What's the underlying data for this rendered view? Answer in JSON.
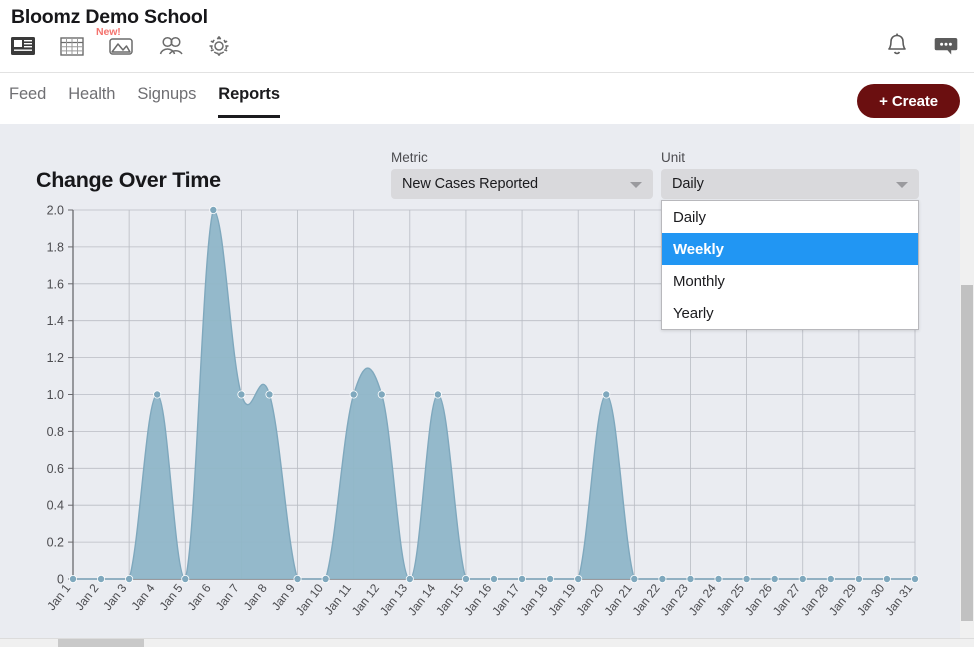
{
  "header": {
    "school_title": "Bloomz Demo School",
    "nav_icons": [
      {
        "name": "feed-icon",
        "label": "Feed"
      },
      {
        "name": "calendar-icon",
        "label": "Calendar"
      },
      {
        "name": "photos-icon",
        "label": "Photos",
        "badge": "New!"
      },
      {
        "name": "people-icon",
        "label": "People"
      },
      {
        "name": "settings-gear-icon",
        "label": "Settings"
      }
    ],
    "new_badge": "New!",
    "notification_icon": "bell-icon",
    "messages_icon": "chat-bubble-icon"
  },
  "subnav": {
    "tabs": [
      {
        "label": "Feed",
        "active": false
      },
      {
        "label": "Health",
        "active": false
      },
      {
        "label": "Signups",
        "active": false
      },
      {
        "label": "Reports",
        "active": true
      }
    ],
    "create_label": "+ Create"
  },
  "panel": {
    "title": "Change Over Time",
    "metric": {
      "label": "Metric",
      "value": "New Cases Reported",
      "caret_icon": "chevron-down-icon"
    },
    "unit": {
      "label": "Unit",
      "value": "Daily",
      "caret_icon": "chevron-down-icon",
      "open": true,
      "options": [
        {
          "label": "Daily",
          "selected": false
        },
        {
          "label": "Weekly",
          "selected": true
        },
        {
          "label": "Monthly",
          "selected": false
        },
        {
          "label": "Yearly",
          "selected": false
        }
      ]
    }
  },
  "colors": {
    "accent_blue": "#2196f3",
    "create_button": "#6b0f10",
    "area_fill": "#8fb6c8",
    "marker": "#7fa8bd",
    "panel_bg": "#eaecf1",
    "new_badge": "#f4736e",
    "tab_indicator": "#1c9ad6"
  },
  "chart_data": {
    "type": "area",
    "title": "Change Over Time",
    "xlabel": "",
    "ylabel": "",
    "ylim": [
      0,
      2.0
    ],
    "yticks": [
      "0",
      "0.2",
      "0.4",
      "0.6",
      "0.8",
      "1.0",
      "1.2",
      "1.4",
      "1.6",
      "1.8",
      "2.0"
    ],
    "grid": true,
    "legend": "none",
    "smoothing": "spline",
    "markers": true,
    "categories": [
      "Jan 1",
      "Jan 2",
      "Jan 3",
      "Jan 4",
      "Jan 5",
      "Jan 6",
      "Jan 7",
      "Jan 8",
      "Jan 9",
      "Jan 10",
      "Jan 11",
      "Jan 12",
      "Jan 13",
      "Jan 14",
      "Jan 15",
      "Jan 16",
      "Jan 17",
      "Jan 18",
      "Jan 19",
      "Jan 20",
      "Jan 21",
      "Jan 22",
      "Jan 23",
      "Jan 24",
      "Jan 25",
      "Jan 26",
      "Jan 27",
      "Jan 28",
      "Jan 29",
      "Jan 30",
      "Jan 31"
    ],
    "series": [
      {
        "name": "New Cases Reported",
        "values": [
          0,
          0,
          0,
          1,
          0,
          2,
          1,
          1,
          0,
          0,
          1,
          1,
          0,
          1,
          0,
          0,
          0,
          0,
          0,
          1,
          0,
          0,
          0,
          0,
          0,
          0,
          0,
          0,
          0,
          0,
          0
        ]
      }
    ]
  }
}
